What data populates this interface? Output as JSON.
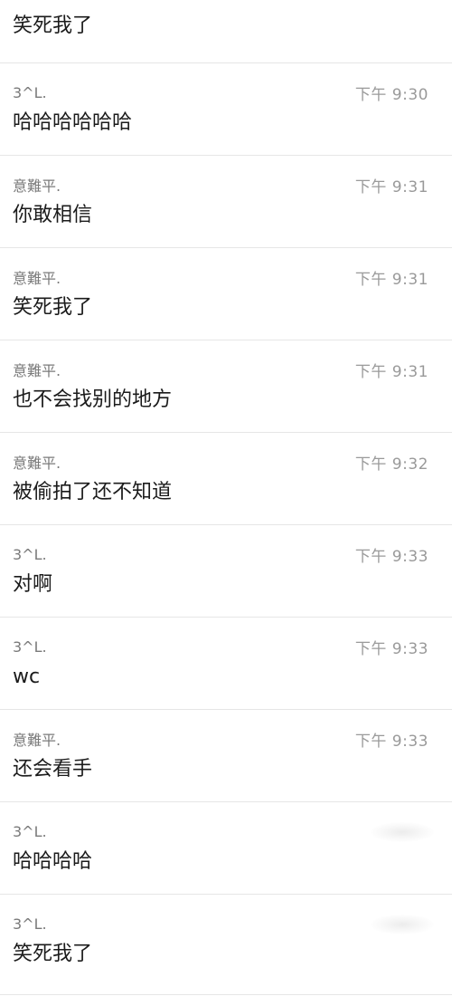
{
  "top_message": {
    "text": "笑死我了"
  },
  "messages": [
    {
      "sender": "3^L.",
      "time": "下午 9:30",
      "text": "哈哈哈哈哈哈"
    },
    {
      "sender": "意難平.",
      "time": "下午 9:31",
      "text": "你敢相信"
    },
    {
      "sender": "意難平.",
      "time": "下午 9:31",
      "text": "笑死我了"
    },
    {
      "sender": "意難平.",
      "time": "下午 9:31",
      "text": "也不会找别的地方"
    },
    {
      "sender": "意難平.",
      "time": "下午 9:32",
      "text": "被偷拍了还不知道"
    },
    {
      "sender": "3^L.",
      "time": "下午 9:33",
      "text": "对啊"
    },
    {
      "sender": "3^L.",
      "time": "下午 9:33",
      "text": "wc"
    },
    {
      "sender": "意難平.",
      "time": "下午 9:33",
      "text": "还会看手"
    },
    {
      "sender": "3^L.",
      "time": "",
      "text": "哈哈哈哈"
    },
    {
      "sender": "3^L.",
      "time": "",
      "text": "笑死我了"
    }
  ]
}
